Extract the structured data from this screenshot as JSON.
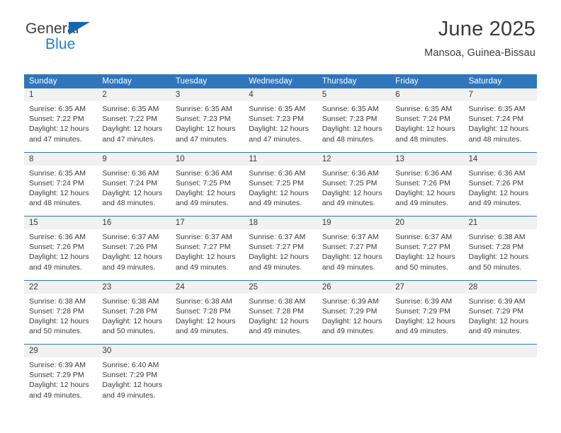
{
  "brand": {
    "name_part1": "General",
    "name_part2": "Blue",
    "accent_color": "#1f7fd0",
    "triangle_color": "#1567b2"
  },
  "header": {
    "title": "June 2025",
    "subtitle": "Mansoa, Guinea-Bissau"
  },
  "calendar": {
    "header_bg": "#2f76bc",
    "daynum_bg": "#f1f1f1",
    "weekdays": [
      "Sunday",
      "Monday",
      "Tuesday",
      "Wednesday",
      "Thursday",
      "Friday",
      "Saturday"
    ],
    "weeks": [
      [
        {
          "day": "1",
          "sunrise": "Sunrise: 6:35 AM",
          "sunset": "Sunset: 7:22 PM",
          "daylight1": "Daylight: 12 hours",
          "daylight2": "and 47 minutes."
        },
        {
          "day": "2",
          "sunrise": "Sunrise: 6:35 AM",
          "sunset": "Sunset: 7:22 PM",
          "daylight1": "Daylight: 12 hours",
          "daylight2": "and 47 minutes."
        },
        {
          "day": "3",
          "sunrise": "Sunrise: 6:35 AM",
          "sunset": "Sunset: 7:23 PM",
          "daylight1": "Daylight: 12 hours",
          "daylight2": "and 47 minutes."
        },
        {
          "day": "4",
          "sunrise": "Sunrise: 6:35 AM",
          "sunset": "Sunset: 7:23 PM",
          "daylight1": "Daylight: 12 hours",
          "daylight2": "and 47 minutes."
        },
        {
          "day": "5",
          "sunrise": "Sunrise: 6:35 AM",
          "sunset": "Sunset: 7:23 PM",
          "daylight1": "Daylight: 12 hours",
          "daylight2": "and 48 minutes."
        },
        {
          "day": "6",
          "sunrise": "Sunrise: 6:35 AM",
          "sunset": "Sunset: 7:24 PM",
          "daylight1": "Daylight: 12 hours",
          "daylight2": "and 48 minutes."
        },
        {
          "day": "7",
          "sunrise": "Sunrise: 6:35 AM",
          "sunset": "Sunset: 7:24 PM",
          "daylight1": "Daylight: 12 hours",
          "daylight2": "and 48 minutes."
        }
      ],
      [
        {
          "day": "8",
          "sunrise": "Sunrise: 6:35 AM",
          "sunset": "Sunset: 7:24 PM",
          "daylight1": "Daylight: 12 hours",
          "daylight2": "and 48 minutes."
        },
        {
          "day": "9",
          "sunrise": "Sunrise: 6:36 AM",
          "sunset": "Sunset: 7:24 PM",
          "daylight1": "Daylight: 12 hours",
          "daylight2": "and 48 minutes."
        },
        {
          "day": "10",
          "sunrise": "Sunrise: 6:36 AM",
          "sunset": "Sunset: 7:25 PM",
          "daylight1": "Daylight: 12 hours",
          "daylight2": "and 49 minutes."
        },
        {
          "day": "11",
          "sunrise": "Sunrise: 6:36 AM",
          "sunset": "Sunset: 7:25 PM",
          "daylight1": "Daylight: 12 hours",
          "daylight2": "and 49 minutes."
        },
        {
          "day": "12",
          "sunrise": "Sunrise: 6:36 AM",
          "sunset": "Sunset: 7:25 PM",
          "daylight1": "Daylight: 12 hours",
          "daylight2": "and 49 minutes."
        },
        {
          "day": "13",
          "sunrise": "Sunrise: 6:36 AM",
          "sunset": "Sunset: 7:26 PM",
          "daylight1": "Daylight: 12 hours",
          "daylight2": "and 49 minutes."
        },
        {
          "day": "14",
          "sunrise": "Sunrise: 6:36 AM",
          "sunset": "Sunset: 7:26 PM",
          "daylight1": "Daylight: 12 hours",
          "daylight2": "and 49 minutes."
        }
      ],
      [
        {
          "day": "15",
          "sunrise": "Sunrise: 6:36 AM",
          "sunset": "Sunset: 7:26 PM",
          "daylight1": "Daylight: 12 hours",
          "daylight2": "and 49 minutes."
        },
        {
          "day": "16",
          "sunrise": "Sunrise: 6:37 AM",
          "sunset": "Sunset: 7:26 PM",
          "daylight1": "Daylight: 12 hours",
          "daylight2": "and 49 minutes."
        },
        {
          "day": "17",
          "sunrise": "Sunrise: 6:37 AM",
          "sunset": "Sunset: 7:27 PM",
          "daylight1": "Daylight: 12 hours",
          "daylight2": "and 49 minutes."
        },
        {
          "day": "18",
          "sunrise": "Sunrise: 6:37 AM",
          "sunset": "Sunset: 7:27 PM",
          "daylight1": "Daylight: 12 hours",
          "daylight2": "and 49 minutes."
        },
        {
          "day": "19",
          "sunrise": "Sunrise: 6:37 AM",
          "sunset": "Sunset: 7:27 PM",
          "daylight1": "Daylight: 12 hours",
          "daylight2": "and 49 minutes."
        },
        {
          "day": "20",
          "sunrise": "Sunrise: 6:37 AM",
          "sunset": "Sunset: 7:27 PM",
          "daylight1": "Daylight: 12 hours",
          "daylight2": "and 50 minutes."
        },
        {
          "day": "21",
          "sunrise": "Sunrise: 6:38 AM",
          "sunset": "Sunset: 7:28 PM",
          "daylight1": "Daylight: 12 hours",
          "daylight2": "and 50 minutes."
        }
      ],
      [
        {
          "day": "22",
          "sunrise": "Sunrise: 6:38 AM",
          "sunset": "Sunset: 7:28 PM",
          "daylight1": "Daylight: 12 hours",
          "daylight2": "and 50 minutes."
        },
        {
          "day": "23",
          "sunrise": "Sunrise: 6:38 AM",
          "sunset": "Sunset: 7:28 PM",
          "daylight1": "Daylight: 12 hours",
          "daylight2": "and 50 minutes."
        },
        {
          "day": "24",
          "sunrise": "Sunrise: 6:38 AM",
          "sunset": "Sunset: 7:28 PM",
          "daylight1": "Daylight: 12 hours",
          "daylight2": "and 49 minutes."
        },
        {
          "day": "25",
          "sunrise": "Sunrise: 6:38 AM",
          "sunset": "Sunset: 7:28 PM",
          "daylight1": "Daylight: 12 hours",
          "daylight2": "and 49 minutes."
        },
        {
          "day": "26",
          "sunrise": "Sunrise: 6:39 AM",
          "sunset": "Sunset: 7:29 PM",
          "daylight1": "Daylight: 12 hours",
          "daylight2": "and 49 minutes."
        },
        {
          "day": "27",
          "sunrise": "Sunrise: 6:39 AM",
          "sunset": "Sunset: 7:29 PM",
          "daylight1": "Daylight: 12 hours",
          "daylight2": "and 49 minutes."
        },
        {
          "day": "28",
          "sunrise": "Sunrise: 6:39 AM",
          "sunset": "Sunset: 7:29 PM",
          "daylight1": "Daylight: 12 hours",
          "daylight2": "and 49 minutes."
        }
      ],
      [
        {
          "day": "29",
          "sunrise": "Sunrise: 6:39 AM",
          "sunset": "Sunset: 7:29 PM",
          "daylight1": "Daylight: 12 hours",
          "daylight2": "and 49 minutes."
        },
        {
          "day": "30",
          "sunrise": "Sunrise: 6:40 AM",
          "sunset": "Sunset: 7:29 PM",
          "daylight1": "Daylight: 12 hours",
          "daylight2": "and 49 minutes."
        },
        {
          "day": "",
          "sunrise": "",
          "sunset": "",
          "daylight1": "",
          "daylight2": ""
        },
        {
          "day": "",
          "sunrise": "",
          "sunset": "",
          "daylight1": "",
          "daylight2": ""
        },
        {
          "day": "",
          "sunrise": "",
          "sunset": "",
          "daylight1": "",
          "daylight2": ""
        },
        {
          "day": "",
          "sunrise": "",
          "sunset": "",
          "daylight1": "",
          "daylight2": ""
        },
        {
          "day": "",
          "sunrise": "",
          "sunset": "",
          "daylight1": "",
          "daylight2": ""
        }
      ]
    ]
  }
}
